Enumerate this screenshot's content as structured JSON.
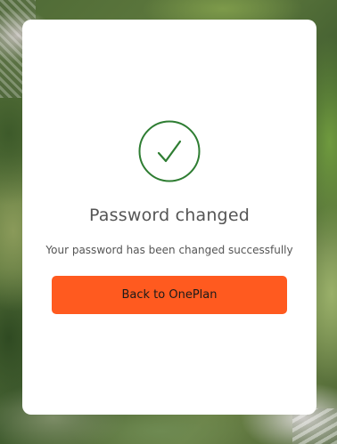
{
  "card": {
    "icon": "check-circle-icon",
    "title": "Password changed",
    "message": "Your password has been changed successfully",
    "button_label": "Back to OnePlan"
  },
  "colors": {
    "accent": "#ff5a1f",
    "success": "#2e7d32",
    "text": "#555555",
    "card_background": "#ffffff"
  }
}
